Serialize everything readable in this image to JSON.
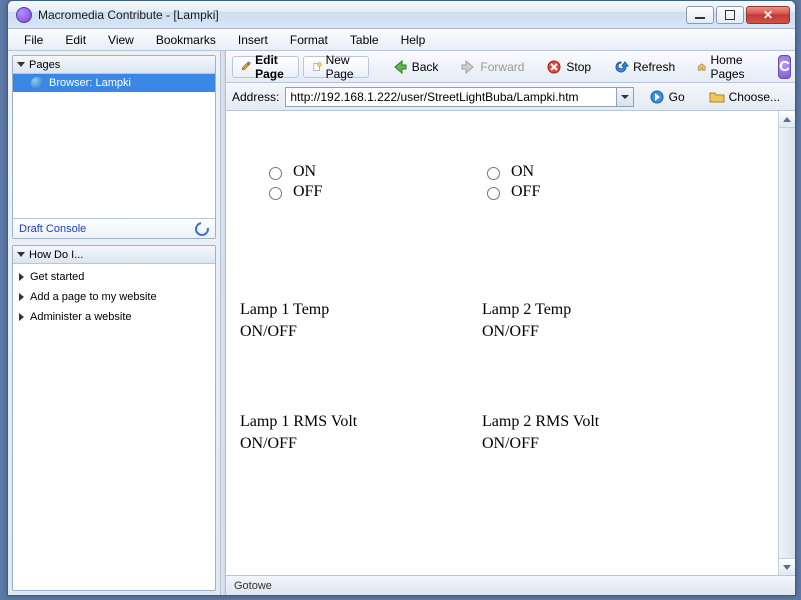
{
  "window": {
    "title": "Macromedia Contribute - [Lampki]"
  },
  "menu": {
    "file": "File",
    "edit": "Edit",
    "view": "View",
    "bookmarks": "Bookmarks",
    "insert": "Insert",
    "format": "Format",
    "table": "Table",
    "help": "Help"
  },
  "sidebar": {
    "pages": {
      "title": "Pages",
      "items": [
        "Browser: Lampki"
      ]
    },
    "draft_console": {
      "label": "Draft Console"
    },
    "howdo": {
      "title": "How Do I...",
      "items": [
        "Get started",
        "Add a page to my website",
        "Administer a website"
      ]
    }
  },
  "toolbar": {
    "edit_page": "Edit Page",
    "new_page": "New Page",
    "back": "Back",
    "forward": "Forward",
    "stop": "Stop",
    "refresh": "Refresh",
    "home_pages": "Home Pages"
  },
  "address": {
    "label": "Address:",
    "url": "http://192.168.1.222/user/StreetLightBuba/Lampki.htm",
    "go": "Go",
    "choose": "Choose..."
  },
  "page": {
    "radios": {
      "on": "ON",
      "off": "OFF"
    },
    "lamp1_temp": "Lamp 1 Temp",
    "lamp2_temp": "Lamp 2 Temp",
    "lamp1_rms": "Lamp 1 RMS Volt",
    "lamp2_rms": "Lamp 2 RMS Volt",
    "onoff": "ON/OFF"
  },
  "status": {
    "text": "Gotowe"
  }
}
